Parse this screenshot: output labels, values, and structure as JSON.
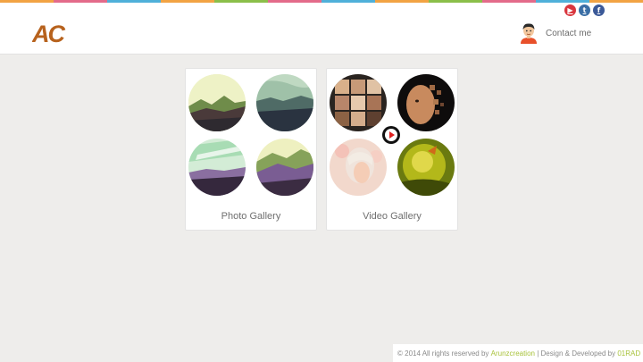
{
  "colors": {
    "stripe": [
      "#f2a343",
      "#e36b8a",
      "#4fb0d9",
      "#f2a343",
      "#8bbf4a",
      "#e36b8a",
      "#4fb0d9",
      "#f2a343",
      "#8bbf4a",
      "#e36b8a",
      "#4fb0d9",
      "#f2a343"
    ],
    "accent_link": "#a8c23a",
    "logo": "#b7621d"
  },
  "header": {
    "logo_text": "AC",
    "social": [
      {
        "name": "youtube-icon",
        "glyph": "▶",
        "color": "#d9363e"
      },
      {
        "name": "twitter-icon",
        "glyph": "t",
        "color": "#3a6ea5"
      },
      {
        "name": "facebook-icon",
        "glyph": "f",
        "color": "#3b5998"
      }
    ],
    "contact_label": "Contact me"
  },
  "galleries": [
    {
      "title": "Photo Gallery"
    },
    {
      "title": "Video Gallery"
    }
  ],
  "footer": {
    "copyright": "© 2014 All rights reserved by",
    "owner_link": "Arunzcreation",
    "separator": "| Design & Developed by",
    "developer_link": "01RAD"
  }
}
